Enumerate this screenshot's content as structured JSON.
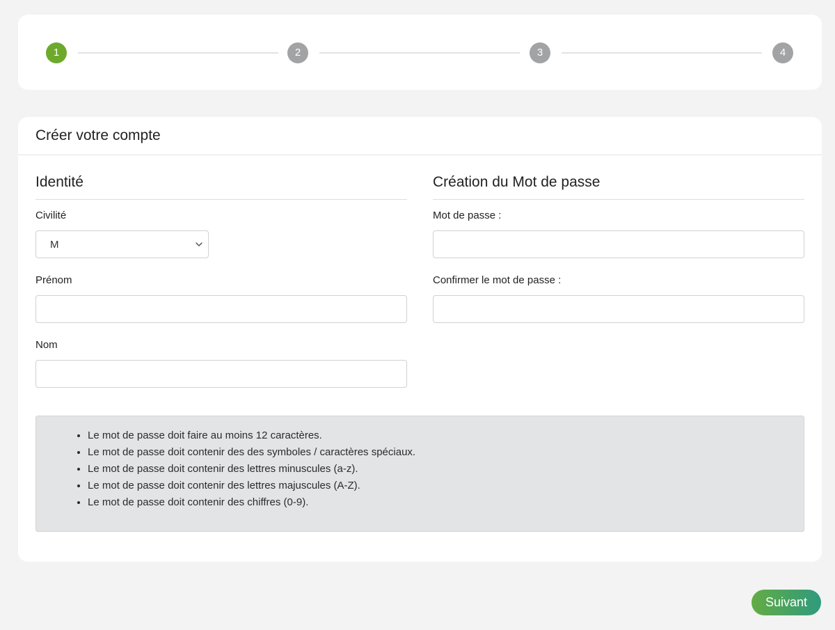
{
  "stepper": {
    "steps": [
      "1",
      "2",
      "3",
      "4"
    ],
    "active_step": 1,
    "active_color": "#6daa2c",
    "inactive_color": "#a1a3a5"
  },
  "form": {
    "title": "Créer votre compte",
    "identity": {
      "section_title": "Identité",
      "civility_label": "Civilité",
      "civility_value": "M",
      "firstname_label": "Prénom",
      "firstname_value": "",
      "lastname_label": "Nom",
      "lastname_value": ""
    },
    "password": {
      "section_title": "Création du Mot de passe",
      "password_label": "Mot de passe :",
      "password_value": "",
      "confirm_label": "Confirmer le mot de passe :",
      "confirm_value": ""
    },
    "rules": [
      "Le mot de passe doit faire au moins 12 caractères.",
      "Le mot de passe doit contenir des des symboles / caractères spéciaux.",
      "Le mot de passe doit contenir des lettres minuscules (a-z).",
      "Le mot de passe doit contenir des lettres majuscules (A-Z).",
      "Le mot de passe doit contenir des chiffres (0-9)."
    ]
  },
  "actions": {
    "next_label": "Suivant"
  },
  "colors": {
    "accent_start": "#63ac43",
    "accent_end": "#2f9a7e",
    "background": "#f3f3f3"
  }
}
